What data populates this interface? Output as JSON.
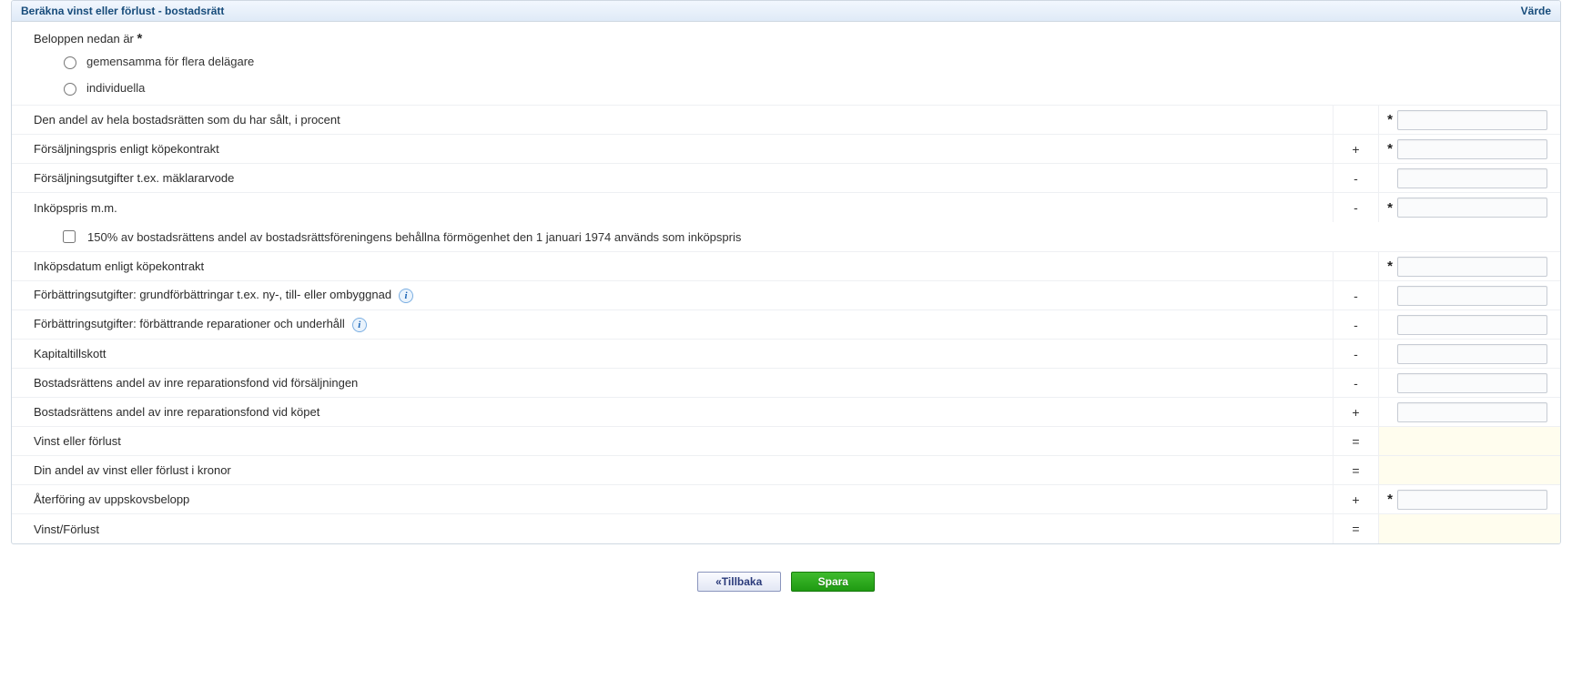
{
  "header": {
    "title_left": "Beräkna vinst eller förlust - bostadsrätt",
    "title_right": "Värde"
  },
  "question": {
    "label": "Beloppen nedan är",
    "options": [
      {
        "label": "gemensamma för flera delägare"
      },
      {
        "label": "individuella"
      }
    ]
  },
  "checkbox_row": {
    "label": "150% av bostadsrättens andel av bostadsrättsföreningens behållna förmögenhet den 1 januari 1974 används som inköpspris"
  },
  "rows": [
    {
      "label": "Den andel av hela bostadsrätten som du har sålt, i procent",
      "sign": "",
      "required": true,
      "input": true
    },
    {
      "label": "Försäljningspris enligt köpekontrakt",
      "sign": "+",
      "required": true,
      "input": true
    },
    {
      "label": "Försäljningsutgifter t.ex. mäklararvode",
      "sign": "-",
      "required": false,
      "input": true
    },
    {
      "label": "Inköpspris m.m.",
      "sign": "-",
      "required": true,
      "input": true
    },
    {
      "label": "Inköpsdatum enligt köpekontrakt",
      "sign": "",
      "required": true,
      "input": true
    },
    {
      "label": "Förbättringsutgifter: grundförbättringar t.ex. ny-, till- eller ombyggnad",
      "sign": "-",
      "required": false,
      "input": true,
      "info": true
    },
    {
      "label": "Förbättringsutgifter: förbättrande reparationer och underhåll",
      "sign": "-",
      "required": false,
      "input": true,
      "info": true
    },
    {
      "label": "Kapitaltillskott",
      "sign": "-",
      "required": false,
      "input": true
    },
    {
      "label": "Bostadsrättens andel av inre reparationsfond vid försäljningen",
      "sign": "-",
      "required": false,
      "input": true
    },
    {
      "label": "Bostadsrättens andel av inre reparationsfond vid köpet",
      "sign": "+",
      "required": false,
      "input": true
    },
    {
      "label": "Vinst eller förlust",
      "sign": "=",
      "required": false,
      "input": false,
      "yellow": true
    },
    {
      "label": "Din andel av vinst eller förlust i kronor",
      "sign": "=",
      "required": false,
      "input": false,
      "yellow": true
    },
    {
      "label": "Återföring av uppskovsbelopp",
      "sign": "+",
      "required": true,
      "input": true
    },
    {
      "label": "Vinst/Förlust",
      "sign": "=",
      "required": false,
      "input": false,
      "yellow": true
    }
  ],
  "buttons": {
    "back": "«Tillbaka",
    "save": "Spara"
  }
}
